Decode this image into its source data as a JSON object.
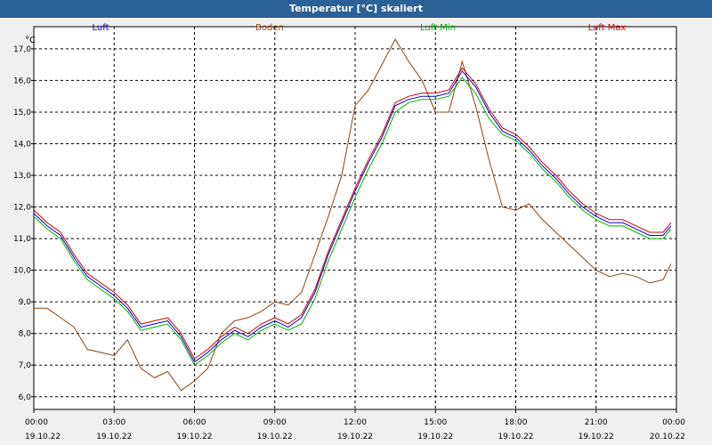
{
  "title": "Temperatur [°C] skaliert",
  "colors": {
    "titlebar": "#2a6095",
    "luft": "#0000cc",
    "boden": "#8b4513",
    "luft_min": "#00b000",
    "luft_max": "#cc0000",
    "teal": "#00a0a0",
    "magenta": "#b000b0"
  },
  "chart_data": {
    "type": "line",
    "title": "Temperatur [°C] skaliert",
    "ylabel": "°C",
    "ylim": [
      5.6,
      17.7
    ],
    "xlim": [
      0,
      24
    ],
    "grid": true,
    "legend": "top",
    "yticks": [
      "6,0",
      "7,0",
      "8,0",
      "9,0",
      "10,0",
      "11,0",
      "12,0",
      "13,0",
      "14,0",
      "15,0",
      "16,0",
      "17,0"
    ],
    "xticks": [
      {
        "time": "00:00",
        "date": "19.10.22"
      },
      {
        "time": "03:00",
        "date": "19.10.22"
      },
      {
        "time": "06:00",
        "date": "19.10.22"
      },
      {
        "time": "09:00",
        "date": "19.10.22"
      },
      {
        "time": "12:00",
        "date": "19.10.22"
      },
      {
        "time": "15:00",
        "date": "19.10.22"
      },
      {
        "time": "18:00",
        "date": "19.10.22"
      },
      {
        "time": "21:00",
        "date": "19.10.22"
      },
      {
        "time": "00:00",
        "date": "20.10.22"
      }
    ],
    "series": [
      {
        "name": "Luft",
        "x": [
          0,
          0.5,
          1,
          1.5,
          2,
          2.5,
          3,
          3.5,
          4,
          4.5,
          5,
          5.5,
          6,
          6.5,
          7,
          7.5,
          8,
          8.5,
          9,
          9.5,
          10,
          10.5,
          11,
          11.5,
          12,
          12.5,
          13,
          13.5,
          14,
          14.5,
          15,
          15.5,
          16,
          16.5,
          17,
          17.5,
          18,
          18.5,
          19,
          19.5,
          20,
          20.5,
          21,
          21.5,
          22,
          22.5,
          23,
          23.5,
          23.8
        ],
        "y": [
          11.8,
          11.4,
          11.1,
          10.4,
          9.8,
          9.5,
          9.2,
          8.8,
          8.2,
          8.3,
          8.4,
          7.9,
          7.1,
          7.4,
          7.8,
          8.1,
          7.9,
          8.2,
          8.4,
          8.2,
          8.5,
          9.3,
          10.5,
          11.5,
          12.5,
          13.4,
          14.2,
          15.2,
          15.4,
          15.5,
          15.5,
          15.6,
          16.3,
          15.8,
          15.0,
          14.4,
          14.2,
          13.8,
          13.3,
          12.9,
          12.4,
          12.0,
          11.7,
          11.5,
          11.5,
          11.3,
          11.1,
          11.1,
          11.4
        ]
      },
      {
        "name": "Boden",
        "x": [
          0,
          0.5,
          1,
          1.5,
          2,
          2.5,
          3,
          3.5,
          4,
          4.5,
          5,
          5.5,
          6,
          6.5,
          7,
          7.5,
          8,
          8.5,
          9,
          9.5,
          10,
          10.5,
          11,
          11.5,
          12,
          12.5,
          13,
          13.5,
          14,
          14.5,
          15,
          15.5,
          16,
          16.5,
          17,
          17.5,
          18,
          18.5,
          19,
          19.5,
          20,
          20.5,
          21,
          21.5,
          22,
          22.5,
          23,
          23.5,
          23.8
        ],
        "y": [
          8.8,
          8.8,
          8.5,
          8.2,
          7.5,
          7.4,
          7.3,
          7.8,
          6.9,
          6.6,
          6.8,
          6.2,
          6.5,
          6.9,
          8.0,
          8.4,
          8.5,
          8.7,
          9.0,
          8.9,
          9.3,
          10.5,
          11.7,
          13.0,
          15.2,
          15.7,
          16.5,
          17.3,
          16.6,
          16.0,
          15.0,
          15.0,
          16.6,
          15.2,
          13.5,
          12.0,
          11.9,
          12.1,
          11.6,
          11.2,
          10.8,
          10.4,
          10.0,
          9.8,
          9.9,
          9.8,
          9.6,
          9.7,
          10.2
        ]
      },
      {
        "name": "Luft Min",
        "x": [
          0,
          0.5,
          1,
          1.5,
          2,
          2.5,
          3,
          3.5,
          4,
          4.5,
          5,
          5.5,
          6,
          6.5,
          7,
          7.5,
          8,
          8.5,
          9,
          9.5,
          10,
          10.5,
          11,
          11.5,
          12,
          12.5,
          13,
          13.5,
          14,
          14.5,
          15,
          15.5,
          16,
          16.5,
          17,
          17.5,
          18,
          18.5,
          19,
          19.5,
          20,
          20.5,
          21,
          21.5,
          22,
          22.5,
          23,
          23.5,
          23.8
        ],
        "y": [
          11.7,
          11.3,
          11.0,
          10.3,
          9.7,
          9.4,
          9.1,
          8.7,
          8.1,
          8.2,
          8.3,
          7.8,
          7.0,
          7.3,
          7.7,
          8.0,
          7.8,
          8.1,
          8.3,
          8.1,
          8.3,
          9.1,
          10.3,
          11.3,
          12.3,
          13.2,
          14.0,
          15.0,
          15.3,
          15.4,
          15.4,
          15.5,
          16.1,
          15.6,
          14.8,
          14.3,
          14.1,
          13.7,
          13.2,
          12.8,
          12.3,
          11.9,
          11.6,
          11.4,
          11.4,
          11.2,
          11.0,
          11.0,
          11.3
        ]
      },
      {
        "name": "Luft Max",
        "x": [
          0,
          0.5,
          1,
          1.5,
          2,
          2.5,
          3,
          3.5,
          4,
          4.5,
          5,
          5.5,
          6,
          6.5,
          7,
          7.5,
          8,
          8.5,
          9,
          9.5,
          10,
          10.5,
          11,
          11.5,
          12,
          12.5,
          13,
          13.5,
          14,
          14.5,
          15,
          15.5,
          16,
          16.5,
          17,
          17.5,
          18,
          18.5,
          19,
          19.5,
          20,
          20.5,
          21,
          21.5,
          22,
          22.5,
          23,
          23.5,
          23.8
        ],
        "y": [
          11.9,
          11.5,
          11.2,
          10.5,
          9.9,
          9.6,
          9.3,
          8.9,
          8.3,
          8.4,
          8.5,
          8.0,
          7.2,
          7.5,
          7.9,
          8.2,
          8.0,
          8.3,
          8.5,
          8.3,
          8.6,
          9.4,
          10.6,
          11.6,
          12.6,
          13.5,
          14.3,
          15.3,
          15.5,
          15.6,
          15.6,
          15.7,
          16.4,
          15.9,
          15.1,
          14.5,
          14.3,
          13.9,
          13.4,
          13.0,
          12.5,
          12.1,
          11.8,
          11.6,
          11.6,
          11.4,
          11.2,
          11.2,
          11.5
        ]
      }
    ]
  }
}
